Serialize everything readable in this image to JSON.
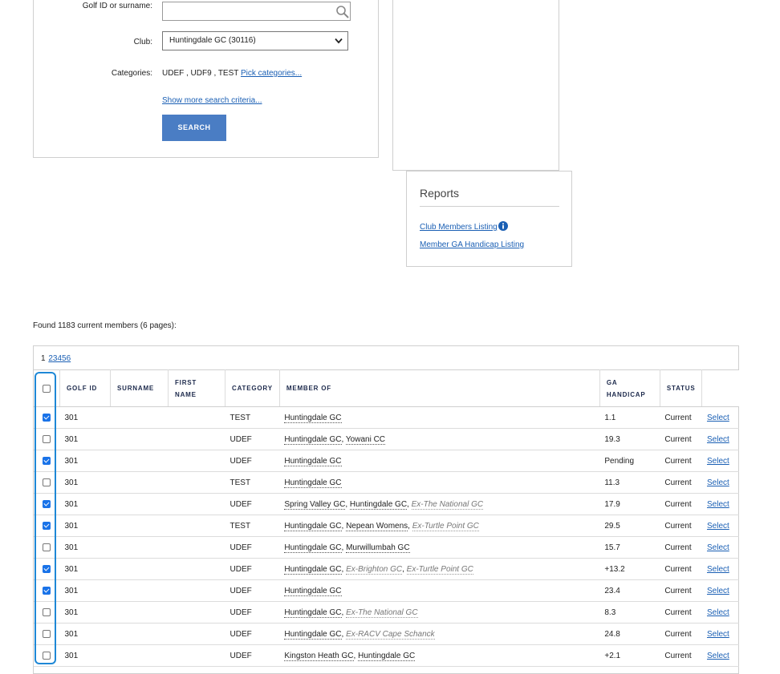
{
  "search": {
    "golf_id_label": "Golf ID or surname:",
    "golf_id_value": "",
    "club_label": "Club:",
    "club_value": "Huntingdale GC (30116)",
    "categories_label": "Categories:",
    "categories_value": "UDEF , UDF9 , TEST",
    "pick_categories": "Pick categories...",
    "show_more": "Show more search criteria...",
    "search_button": "SEARCH"
  },
  "reports": {
    "title": "Reports",
    "links": [
      "Club Members Listing",
      "Member GA Handicap Listing"
    ]
  },
  "results": {
    "summary": "Found 1183 current members (6 pages):",
    "pages": [
      "1",
      "2",
      "3",
      "4",
      "5",
      "6"
    ],
    "columns": [
      "GOLF ID",
      "SURNAME",
      "FIRST NAME",
      "CATEGORY",
      "MEMBER OF",
      "GA HANDICAP",
      "STATUS"
    ],
    "select_label": "Select",
    "rows": [
      {
        "checked": true,
        "golf_id": "301",
        "surname": "",
        "first_name": "",
        "category": "TEST",
        "member_of": [
          {
            "name": "Huntingdale GC",
            "ex": false
          }
        ],
        "handicap": "1.1",
        "status": "Current"
      },
      {
        "checked": false,
        "golf_id": "301",
        "surname": "",
        "first_name": "",
        "category": "UDEF",
        "member_of": [
          {
            "name": "Huntingdale GC",
            "ex": false
          },
          {
            "name": "Yowani CC",
            "ex": false
          }
        ],
        "handicap": "19.3",
        "status": "Current"
      },
      {
        "checked": true,
        "golf_id": "301",
        "surname": "",
        "first_name": "",
        "category": "UDEF",
        "member_of": [
          {
            "name": "Huntingdale GC",
            "ex": false
          }
        ],
        "handicap": "Pending",
        "status": "Current"
      },
      {
        "checked": false,
        "golf_id": "301",
        "surname": "",
        "first_name": "",
        "category": "TEST",
        "member_of": [
          {
            "name": "Huntingdale GC",
            "ex": false
          }
        ],
        "handicap": "11.3",
        "status": "Current"
      },
      {
        "checked": true,
        "golf_id": "301",
        "surname": "",
        "first_name": "",
        "category": "UDEF",
        "member_of": [
          {
            "name": "Spring Valley GC",
            "ex": false
          },
          {
            "name": "Huntingdale GC",
            "ex": false
          },
          {
            "name": "Ex-The National GC",
            "ex": true
          }
        ],
        "handicap": "17.9",
        "status": "Current"
      },
      {
        "checked": true,
        "golf_id": "301",
        "surname": "",
        "first_name": "",
        "category": "TEST",
        "member_of": [
          {
            "name": "Huntingdale GC",
            "ex": false
          },
          {
            "name": "Nepean Womens",
            "ex": false
          },
          {
            "name": "Ex-Turtle Point GC",
            "ex": true
          }
        ],
        "handicap": "29.5",
        "status": "Current"
      },
      {
        "checked": false,
        "golf_id": "301",
        "surname": "",
        "first_name": "",
        "category": "UDEF",
        "member_of": [
          {
            "name": "Huntingdale GC",
            "ex": false
          },
          {
            "name": "Murwillumbah GC",
            "ex": false
          }
        ],
        "handicap": "15.7",
        "status": "Current"
      },
      {
        "checked": true,
        "golf_id": "301",
        "surname": "",
        "first_name": "",
        "category": "UDEF",
        "member_of": [
          {
            "name": "Huntingdale GC",
            "ex": false
          },
          {
            "name": "Ex-Brighton GC",
            "ex": true
          },
          {
            "name": "Ex-Turtle Point GC",
            "ex": true
          }
        ],
        "handicap": "+13.2",
        "status": "Current"
      },
      {
        "checked": true,
        "golf_id": "301",
        "surname": "",
        "first_name": "",
        "category": "UDEF",
        "member_of": [
          {
            "name": "Huntingdale GC",
            "ex": false
          }
        ],
        "handicap": "23.4",
        "status": "Current"
      },
      {
        "checked": false,
        "golf_id": "301",
        "surname": "",
        "first_name": "",
        "category": "UDEF",
        "member_of": [
          {
            "name": "Huntingdale GC",
            "ex": false
          },
          {
            "name": "Ex-The National GC",
            "ex": true
          }
        ],
        "handicap": "8.3",
        "status": "Current"
      },
      {
        "checked": false,
        "golf_id": "301",
        "surname": "",
        "first_name": "",
        "category": "UDEF",
        "member_of": [
          {
            "name": "Huntingdale GC",
            "ex": false
          },
          {
            "name": "Ex-RACV Cape Schanck",
            "ex": true
          }
        ],
        "handicap": "24.8",
        "status": "Current"
      },
      {
        "checked": false,
        "golf_id": "301",
        "surname": "",
        "first_name": "",
        "category": "UDEF",
        "member_of": [
          {
            "name": "Kingston Heath GC",
            "ex": false
          },
          {
            "name": "Huntingdale GC",
            "ex": false
          }
        ],
        "handicap": "+2.1",
        "status": "Current"
      }
    ]
  },
  "colors": {
    "accent": "#4a7dc4",
    "link": "#1a5fb4",
    "highlight": "#1e88d6",
    "checkbox_on": "#1a73e8"
  },
  "icons": [
    "search-icon",
    "chevron-down-icon",
    "info-icon",
    "checkbox-icon"
  ]
}
